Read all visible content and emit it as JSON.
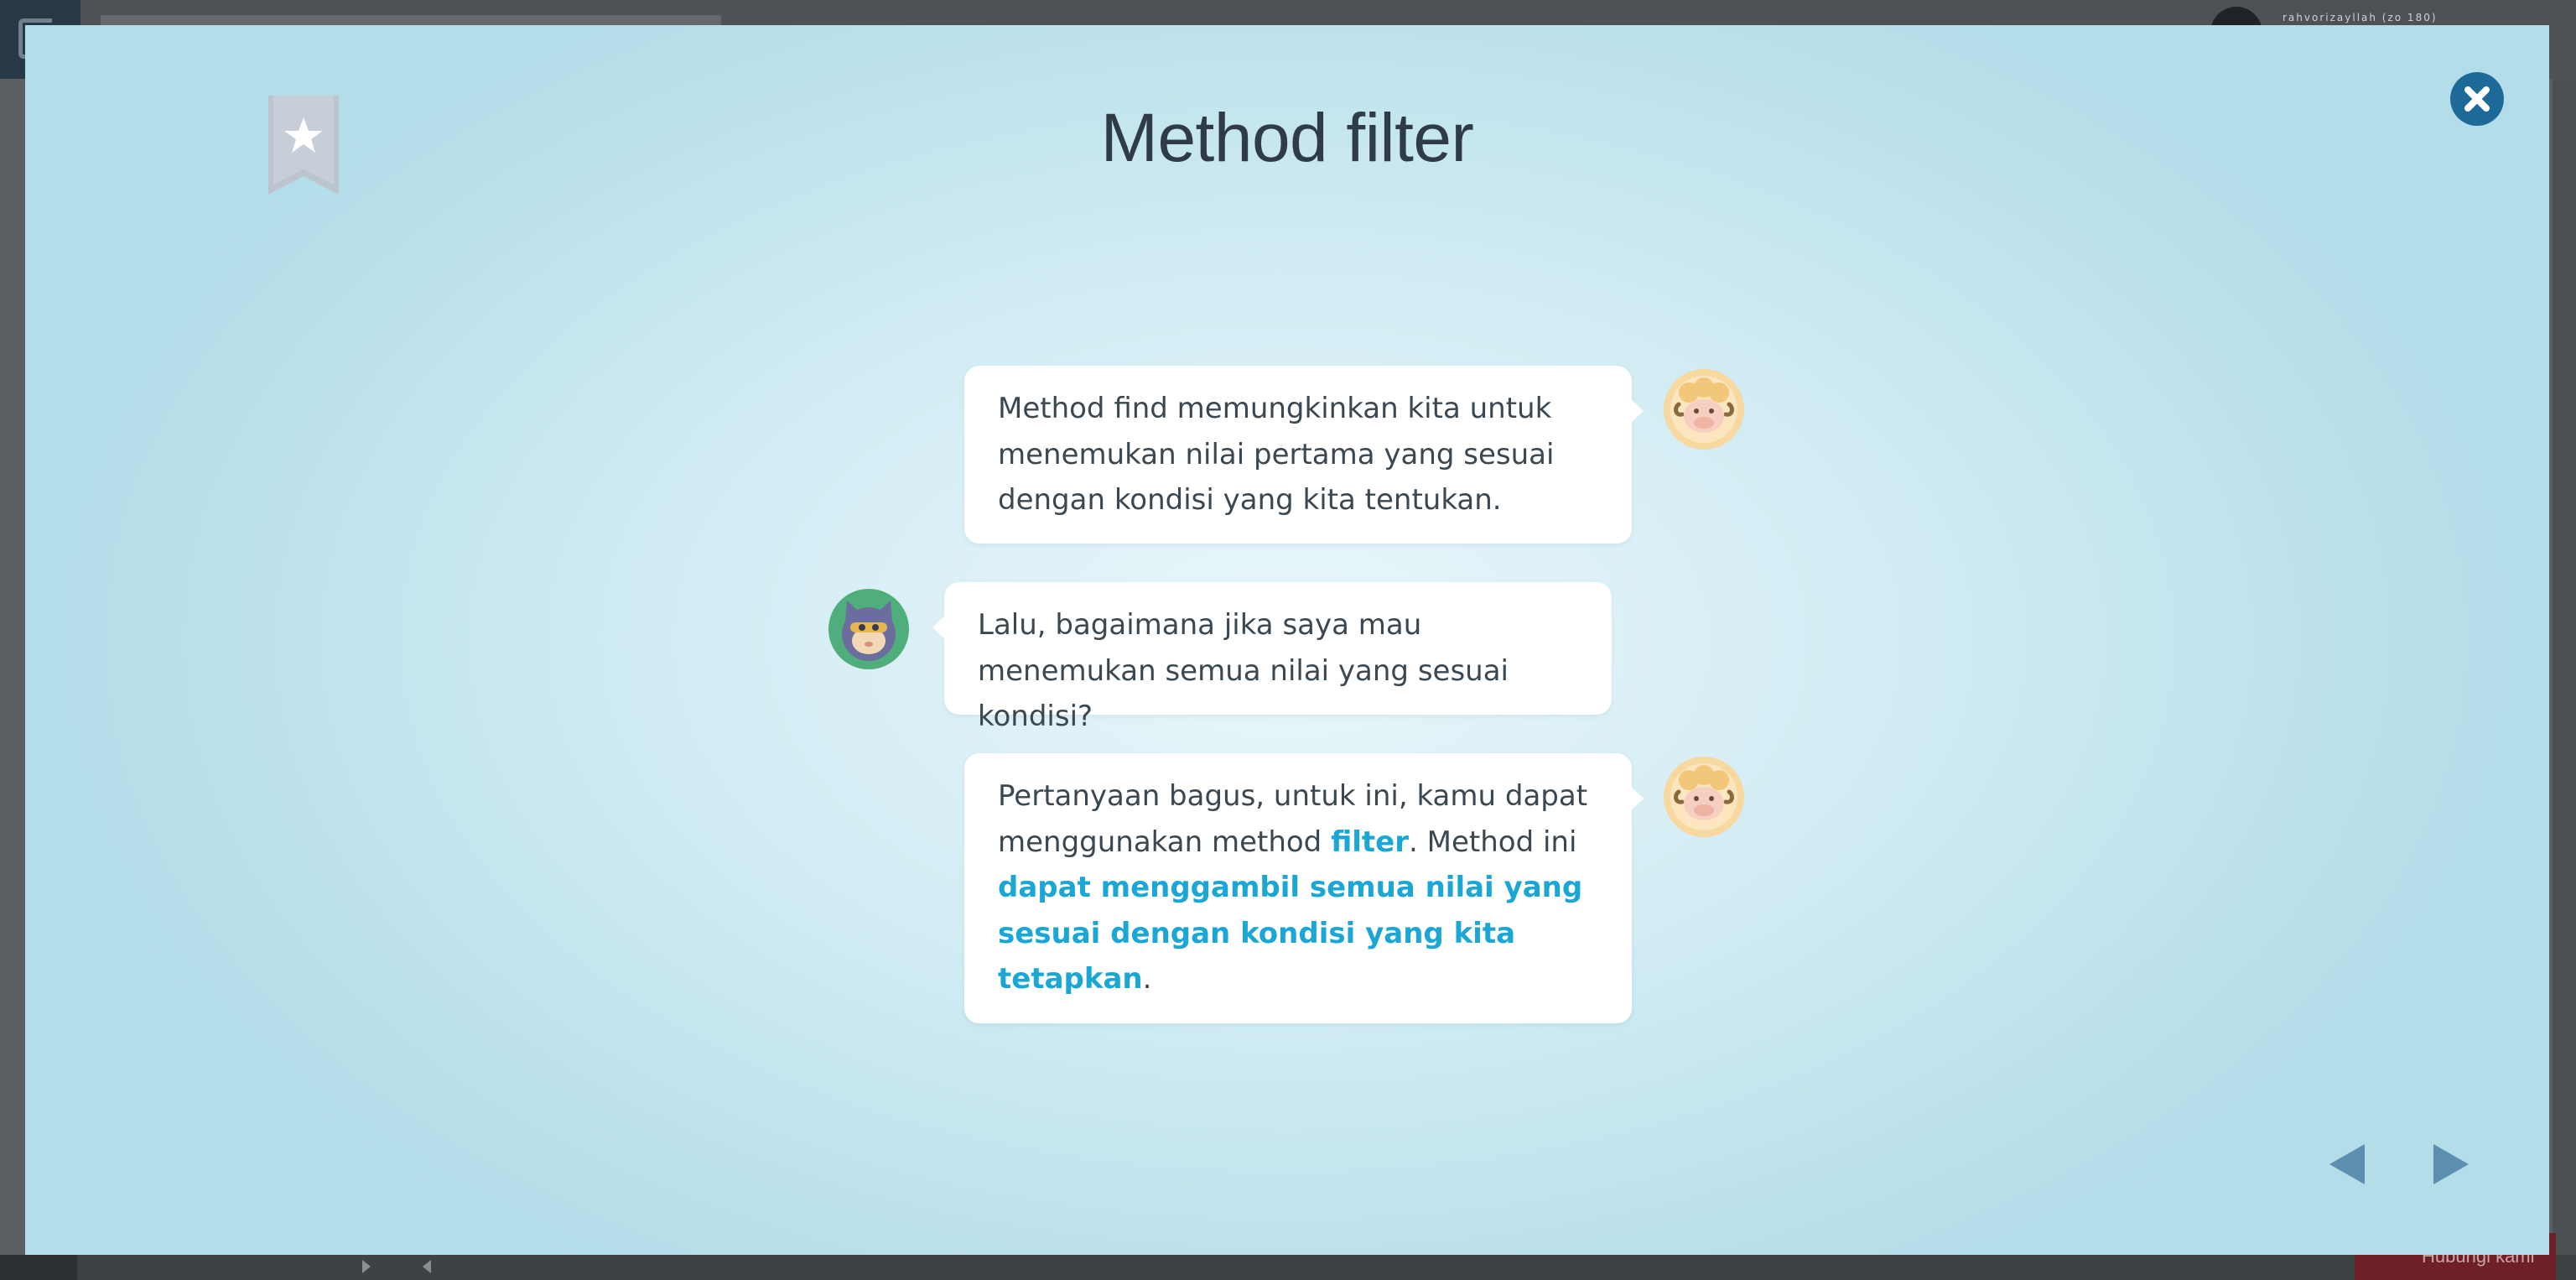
{
  "background": {
    "username": "rahvorizayllah (zo 180)",
    "cta_label": "Hubungi kami"
  },
  "modal": {
    "title": "Method filter",
    "close_icon": "close-icon",
    "bookmark_icon": "bookmark-star-icon",
    "nav": {
      "prev_icon": "triangle-left-icon",
      "next_icon": "triangle-right-icon"
    }
  },
  "chat": {
    "messages": [
      {
        "speaker": "sheep",
        "side": "right",
        "text": "Method find memungkinkan kita untuk menemukan nilai pertama yang sesuai dengan kondisi yang kita tentukan."
      },
      {
        "speaker": "cat",
        "side": "left",
        "text": "Lalu, bagaimana jika saya mau menemukan semua nilai yang sesuai kondisi?"
      },
      {
        "speaker": "sheep",
        "side": "right",
        "part1": "Pertanyaan bagus, untuk ini, kamu dapat menggunakan method ",
        "highlight1": "filter",
        "part2": ". Method ini ",
        "highlight2": "dapat menggambil semua nilai yang sesuai dengan kondisi yang kita tetapkan",
        "part3": "."
      }
    ]
  },
  "colors": {
    "accent": "#1aa7d6",
    "close_button": "#1d6a99",
    "nav_arrow": "#5d8fb0",
    "text": "#3b4852"
  }
}
